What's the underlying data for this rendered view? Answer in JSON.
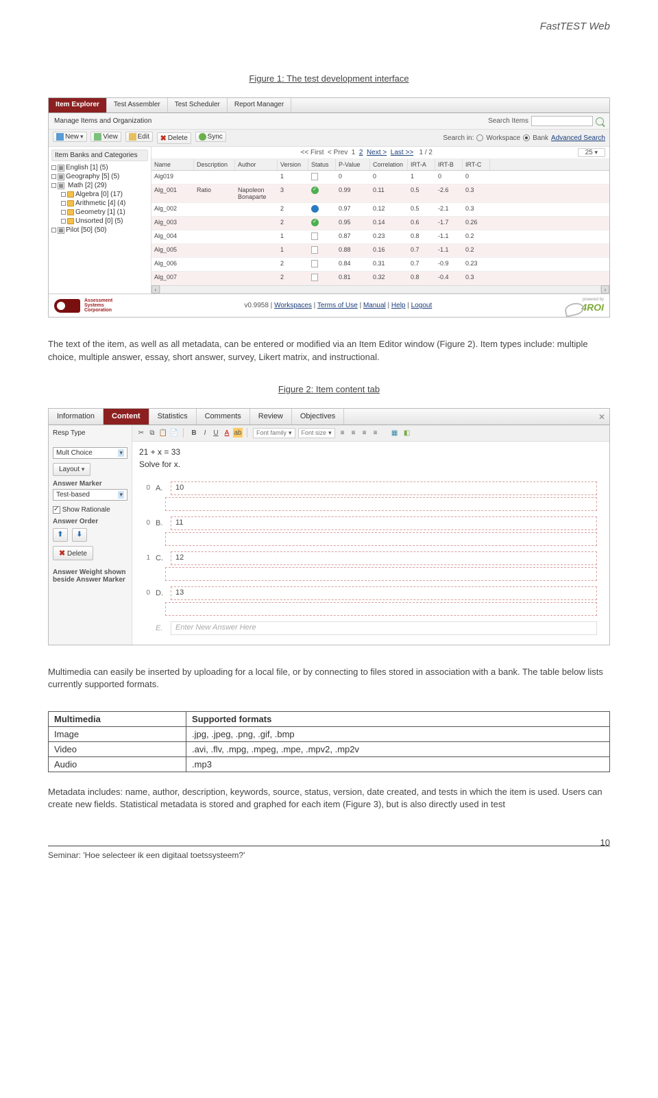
{
  "header": {
    "title": "FastTEST Web"
  },
  "figure1": {
    "caption": "Figure 1: The test development interface"
  },
  "screenshot1": {
    "tabs": [
      "Item Explorer",
      "Test Assembler",
      "Test Scheduler",
      "Report Manager"
    ],
    "manage_label": "Manage Items and Organization",
    "search_label": "Search Items",
    "search_in": "Search in:",
    "ws": "Workspace",
    "bank": "Bank",
    "adv": "Advanced Search",
    "toolbar": {
      "new": "New",
      "view": "View",
      "edit": "Edit",
      "delete": "Delete",
      "sync": "Sync"
    },
    "tree_header": "Item Banks and Categories",
    "tree": [
      "English [1] (5)",
      "Geography [5] (5)",
      "Math [2] (29)",
      "Algebra [0] (17)",
      "Arithmetic [4] (4)",
      "Geometry [1] (1)",
      "Unsorted [0] (5)",
      "Pilot [50] (50)"
    ],
    "pager": {
      "first": "<< First",
      "prev": "< Prev",
      "page1": "1",
      "page2": "2",
      "next": "Next >",
      "last": "Last >>",
      "of": "1 / 2",
      "per": "25"
    },
    "columns": [
      "Name",
      "Description",
      "Author",
      "Version",
      "Status",
      "P-Value",
      "Correlation",
      "IRT-A",
      "IRT-B",
      "IRT-C"
    ],
    "rows": [
      {
        "name": "Alg019",
        "desc": "",
        "author": "",
        "ver": "1",
        "status": "doc",
        "p": "0",
        "corr": "0",
        "a": "1",
        "b": "0",
        "c": "0"
      },
      {
        "name": "Alg_001",
        "desc": "Ratio",
        "author": "Napoleon Bonaparte",
        "ver": "3",
        "status": "ok",
        "p": "0.99",
        "corr": "0.11",
        "a": "0.5",
        "b": "-2.6",
        "c": "0.3"
      },
      {
        "name": "Alg_002",
        "desc": "",
        "author": "",
        "ver": "2",
        "status": "pen",
        "p": "0.97",
        "corr": "0.12",
        "a": "0.5",
        "b": "-2.1",
        "c": "0.3"
      },
      {
        "name": "Alg_003",
        "desc": "",
        "author": "",
        "ver": "2",
        "status": "ok",
        "p": "0.95",
        "corr": "0.14",
        "a": "0.6",
        "b": "-1.7",
        "c": "0.26"
      },
      {
        "name": "Alg_004",
        "desc": "",
        "author": "",
        "ver": "1",
        "status": "doc",
        "p": "0.87",
        "corr": "0.23",
        "a": "0.8",
        "b": "-1.1",
        "c": "0.2"
      },
      {
        "name": "Alg_005",
        "desc": "",
        "author": "",
        "ver": "1",
        "status": "doc",
        "p": "0.88",
        "corr": "0.16",
        "a": "0.7",
        "b": "-1.1",
        "c": "0.2"
      },
      {
        "name": "Alg_006",
        "desc": "",
        "author": "",
        "ver": "2",
        "status": "doc",
        "p": "0.84",
        "corr": "0.31",
        "a": "0.7",
        "b": "-0.9",
        "c": "0.23"
      },
      {
        "name": "Alg_007",
        "desc": "",
        "author": "",
        "ver": "2",
        "status": "doc",
        "p": "0.81",
        "corr": "0.32",
        "a": "0.8",
        "b": "-0.4",
        "c": "0.3"
      }
    ],
    "footer": {
      "logo1": "Assessment Systems Corporation",
      "version": "v0.9958",
      "links": [
        "Workspaces",
        "Terms of Use",
        "Manual",
        "Help",
        "Logout"
      ],
      "logo2": "4ROI",
      "powered": "powered by"
    }
  },
  "para1": "The text of the item, as well as all metadata, can be entered or modified via an Item Editor window (Figure 2).  Item types include: multiple choice, multiple answer, essay, short answer, survey, Likert matrix, and instructional.",
  "figure2": {
    "caption": "Figure 2: Item content tab"
  },
  "screenshot2": {
    "tabs": [
      "Information",
      "Content",
      "Statistics",
      "Comments",
      "Review",
      "Objectives"
    ],
    "side": {
      "resp_type_lbl": "Resp Type",
      "resp_type_val": "Mult Choice",
      "layout": "Layout",
      "marker_lbl": "Answer Marker",
      "marker_val": "Test-based",
      "show_rationale": "Show Rationale",
      "order_lbl": "Answer Order",
      "delete": "Delete",
      "weight": "Answer Weight shown beside Answer Marker"
    },
    "toolbar": {
      "font_family": "Font family",
      "font_size": "Font size"
    },
    "question": "21 + x = 33",
    "instruction": "Solve for x.",
    "answers": [
      {
        "score": "0",
        "lbl": "A.",
        "val": "10"
      },
      {
        "score": "0",
        "lbl": "B.",
        "val": "11"
      },
      {
        "score": "1",
        "lbl": "C.",
        "val": "12"
      },
      {
        "score": "0",
        "lbl": "D.",
        "val": "13"
      }
    ],
    "placeholder": {
      "lbl": "E.",
      "val": "Enter New Answer Here"
    }
  },
  "para2": "Multimedia can easily be inserted by uploading for a local file, or by connecting to files stored in association with a bank.  The table below lists currently supported formats.",
  "fmt_table": {
    "headers": [
      "Multimedia",
      "Supported formats"
    ],
    "rows": [
      [
        "Image",
        ".jpg, .jpeg, .png, .gif, .bmp"
      ],
      [
        "Video",
        ".avi, .flv, .mpg, .mpeg, .mpe, .mpv2, .mp2v"
      ],
      [
        "Audio",
        ".mp3"
      ]
    ]
  },
  "para3": "Metadata includes: name, author, description, keywords, source, status, version, date created, and tests in which the item is used.  Users can create new fields.  Statistical metadata is stored and graphed for each item (Figure 3), but is also directly used in test",
  "footer": {
    "seminar": "Seminar: 'Hoe selecteer ik een digitaal toetssysteem?'",
    "page": "10"
  }
}
